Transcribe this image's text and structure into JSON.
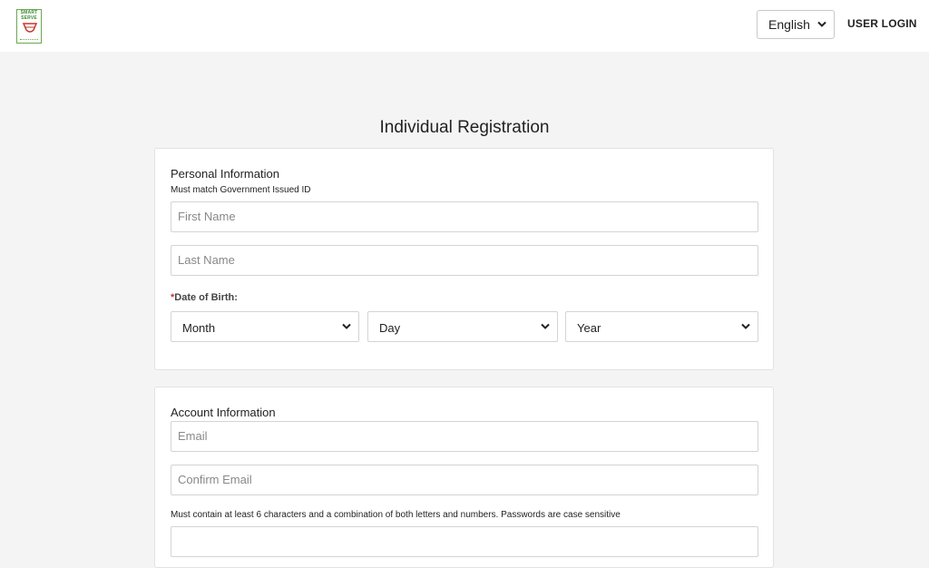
{
  "header": {
    "logo_lines": [
      "SMART",
      "SERVE"
    ],
    "language": {
      "selected": "English"
    },
    "login_label": "USER LOGIN"
  },
  "page": {
    "title": "Individual Registration"
  },
  "personal": {
    "title": "Personal Information",
    "subtitle": "Must match Government Issued ID",
    "first_name_placeholder": "First Name",
    "last_name_placeholder": "Last Name",
    "dob_required_marker": "*",
    "dob_label": "Date of Birth:",
    "month": "Month",
    "day": "Day",
    "year": "Year"
  },
  "account": {
    "title": "Account Information",
    "email_placeholder": "Email",
    "confirm_email_placeholder": "Confirm Email",
    "password_hint": "Must contain at least 6 characters and a combination of both letters and numbers. Passwords are case sensitive"
  },
  "icons": {
    "chevron": "chevron-down-icon",
    "logo": "smart-serve-logo"
  }
}
